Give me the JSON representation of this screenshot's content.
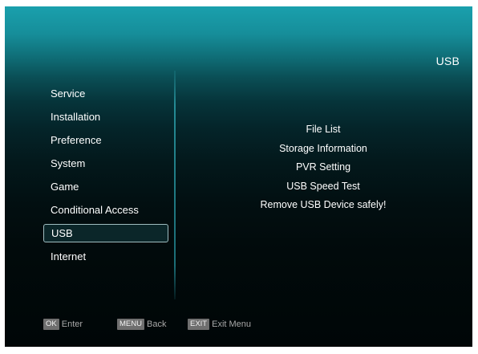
{
  "header": {
    "title": "USB"
  },
  "main_menu": {
    "items": [
      {
        "label": "Service"
      },
      {
        "label": "Installation"
      },
      {
        "label": "Preference"
      },
      {
        "label": "System"
      },
      {
        "label": "Game"
      },
      {
        "label": "Conditional Access"
      },
      {
        "label": "USB",
        "selected": true
      },
      {
        "label": "Internet"
      }
    ]
  },
  "usb_menu": {
    "items": [
      {
        "label": "File List"
      },
      {
        "label": "Storage Information"
      },
      {
        "label": "PVR Setting"
      },
      {
        "label": "USB Speed Test"
      },
      {
        "label": "Remove USB Device safely!"
      }
    ]
  },
  "footer": {
    "hints": [
      {
        "key": "OK",
        "label": "Enter"
      },
      {
        "key": "MENU",
        "label": "Back"
      },
      {
        "key": "EXIT",
        "label": "Exit Menu"
      }
    ]
  },
  "colors": {
    "background_top": "#1aa0ad",
    "background_bottom": "#000607",
    "text": "#ffffff",
    "selected_border": "#9fbcc0",
    "key_badge": "#6f6f6f"
  }
}
